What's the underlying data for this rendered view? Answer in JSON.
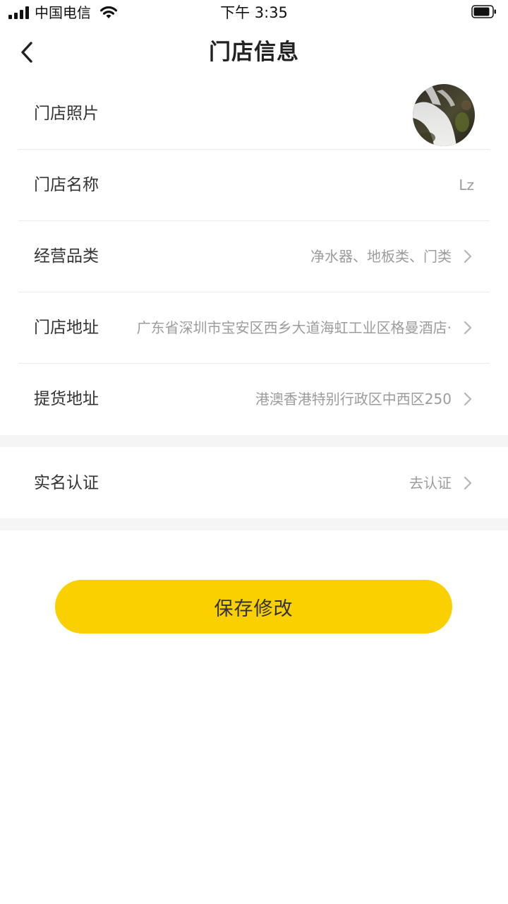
{
  "status_bar": {
    "carrier": "中国电信",
    "time": "下午 3:35"
  },
  "nav": {
    "title": "门店信息",
    "back_icon": "chevron-left-icon"
  },
  "rows": [
    {
      "label": "门店照片",
      "kind": "avatar",
      "image": "waterfall-photo"
    },
    {
      "label": "门店名称",
      "value": "Lz"
    },
    {
      "label": "经营品类",
      "value": "净水器、地板类、门类",
      "icon": "chevron-right-icon"
    },
    {
      "label": "门店地址",
      "value": "广东省深圳市宝安区西乡大道海虹工业区格曼酒店·",
      "icon": "chevron-right-icon"
    },
    {
      "label": "提货地址",
      "value": "港澳香港特别行政区中西区250",
      "icon": "chevron-right-icon"
    },
    {
      "label": "实名认证",
      "value": "去认证",
      "icon": "chevron-right-icon"
    }
  ],
  "save_button": {
    "label": "保存修改"
  },
  "colors": {
    "accent": "#fad000",
    "background": "#ffffff",
    "section_gap": "#f5f5f5",
    "label_text": "#333333",
    "value_text": "#9c9c9c"
  }
}
